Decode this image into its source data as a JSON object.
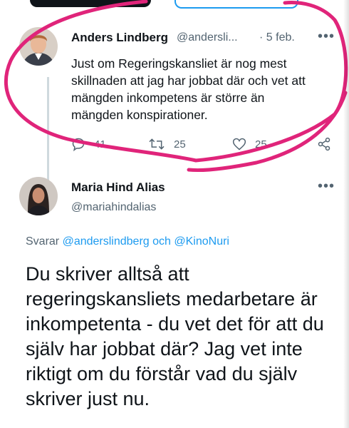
{
  "tweet1": {
    "name": "Anders Lindberg",
    "handle": "@andersli...",
    "date": "· 5 feb.",
    "more": "•••",
    "text": "Just om Regeringskansliet är nog mest skillnaden att jag har jobbat där och vet att mängden inkompetens är större än mängden konspirationer.",
    "stats": {
      "replies": "41",
      "retweets": "25",
      "likes": "25"
    }
  },
  "tweet2": {
    "name": "Maria Hind Alias",
    "handle": "@mariahindalias",
    "more": "•••",
    "reply_prefix": "Svarar",
    "reply_user1": "@anderslindberg",
    "reply_and": "och",
    "reply_user2": "@KinoNuri",
    "text": "Du skriver alltså att regeringskansliets medarbetare är inkompetenta - du vet det för att du själv har jobbat där? Jag vet inte riktigt om du förstår vad du själv skriver just nu."
  },
  "colors": {
    "annotation": "#e0247a",
    "link": "#1d9bf0",
    "muted": "#536471",
    "thread_line": "#cfd9de"
  },
  "icons": [
    "reply-icon",
    "retweet-icon",
    "like-icon",
    "share-icon",
    "more-icon"
  ]
}
